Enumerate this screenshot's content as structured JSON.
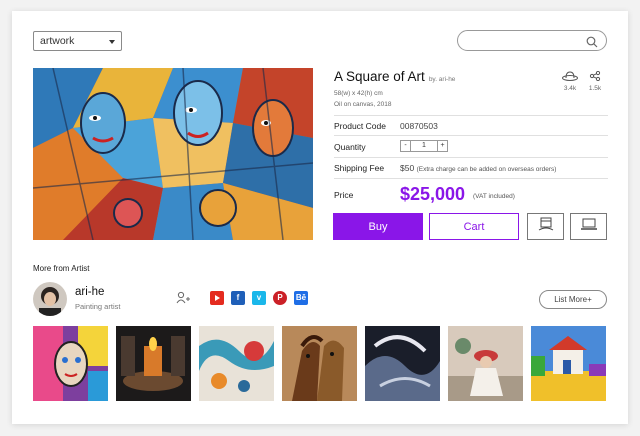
{
  "filter": {
    "selected": "artwork"
  },
  "search": {
    "placeholder": ""
  },
  "artwork": {
    "title": "A Square of Art",
    "by": "by. ari-he",
    "size": "58(w) x 42(h) cm",
    "medium": "Oil on canvas, 2018",
    "stats": [
      {
        "icon": "hat-icon",
        "label": "3.4k"
      },
      {
        "icon": "share-icon",
        "label": "1.5k"
      }
    ]
  },
  "details": {
    "product_code_label": "Product Code",
    "product_code": "00870503",
    "quantity_label": "Quantity",
    "quantity_minus": "-",
    "quantity_value": "1",
    "quantity_plus": "+",
    "shipping_label": "Shipping Fee",
    "shipping_value": "$50",
    "shipping_note": "(Extra charge can be added on overseas orders)",
    "price_label": "Price",
    "price": "$25,000",
    "vat": "(VAT included)"
  },
  "actions": {
    "buy": "Buy",
    "cart": "Cart"
  },
  "artist_section": {
    "heading": "More from Artist",
    "name": "ari-he",
    "role": "Painting artist",
    "list_more": "List More+"
  },
  "social": {
    "behance": "Bē"
  },
  "colors": {
    "accent": "#8a16e8"
  }
}
